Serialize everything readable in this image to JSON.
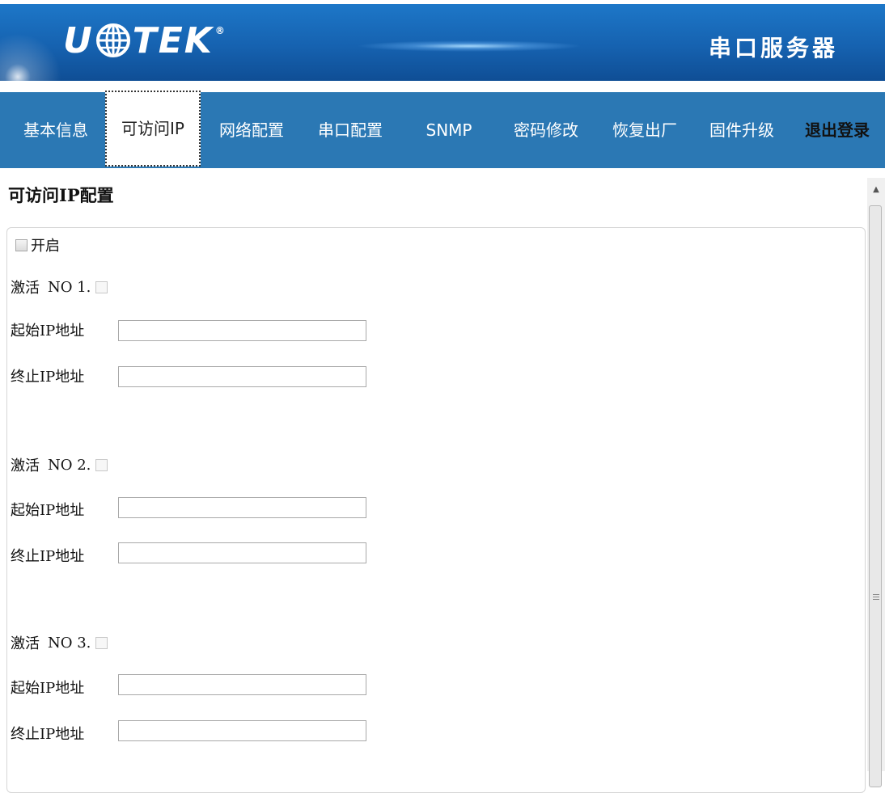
{
  "header": {
    "logo_left": "U",
    "logo_right": "TEK",
    "product_title": "串口服务器"
  },
  "nav": {
    "items": [
      {
        "label": "基本信息"
      },
      {
        "label": "可访问IP"
      },
      {
        "label": "网络配置"
      },
      {
        "label": "串口配置"
      },
      {
        "label": "SNMP"
      },
      {
        "label": "密码修改"
      },
      {
        "label": "恢复出厂"
      },
      {
        "label": "固件升级"
      },
      {
        "label": "退出登录"
      }
    ],
    "active_index": 1
  },
  "page": {
    "title": "可访问IP配置",
    "enable_label": "开启",
    "enable_checked": false
  },
  "rules": [
    {
      "activate_label": "激活",
      "number_label": "NO 1.",
      "start_label": "起始IP地址",
      "start_value": "",
      "end_label": "终止IP地址",
      "end_value": ""
    },
    {
      "activate_label": "激活",
      "number_label": "NO 2.",
      "start_label": "起始IP地址",
      "start_value": "",
      "end_label": "终止IP地址",
      "end_value": ""
    },
    {
      "activate_label": "激活",
      "number_label": "NO 3.",
      "start_label": "起始IP地址",
      "start_value": "",
      "end_label": "终止IP地址",
      "end_value": ""
    }
  ],
  "colors": {
    "header_blue": "#1662b0",
    "nav_blue": "#2b78b4"
  }
}
